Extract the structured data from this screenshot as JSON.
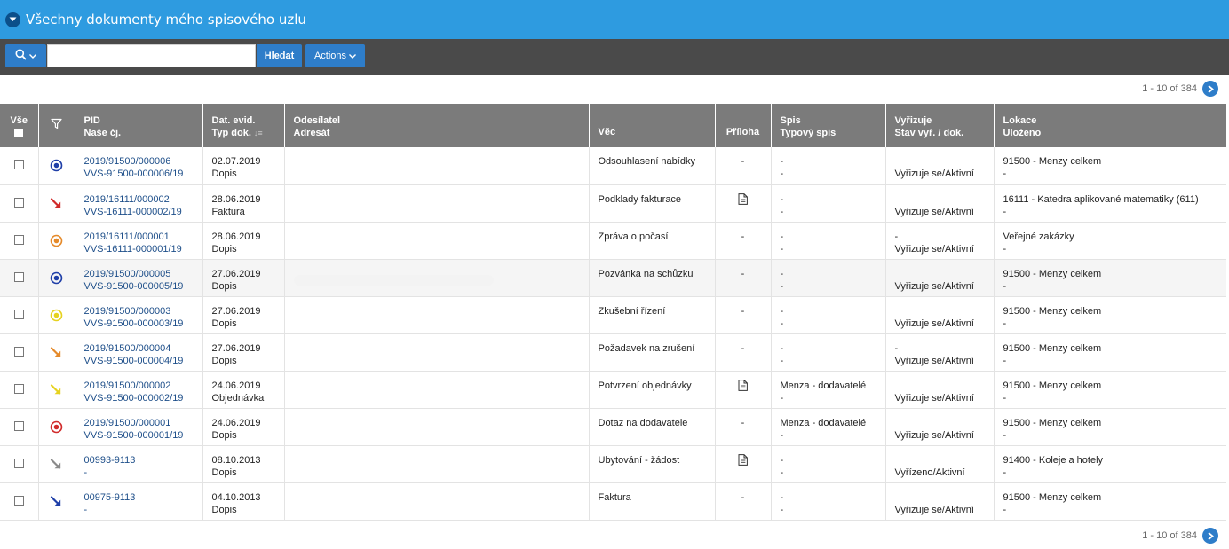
{
  "header": {
    "title": "Všechny dokumenty mého spisového uzlu",
    "colors": {
      "titlebar": "#2e9be0",
      "toolbar": "#4a4a4a",
      "button": "#2e7dc9",
      "table_header": "#7b7b7b"
    }
  },
  "toolbar": {
    "search_value": "",
    "search_button_label": "Hledat",
    "actions_label": "Actions",
    "search_icon": "search-icon"
  },
  "pagination": {
    "label": "1 - 10 of 384"
  },
  "columns": {
    "select_all": "Vše",
    "pid": "PID",
    "our_ref": "Naše čj.",
    "date": "Dat. evid.",
    "doc_type": "Typ dok.",
    "sender": "Odesílatel",
    "addressee": "Adresát",
    "subject": "Věc",
    "attachment": "Příloha",
    "file": "Spis",
    "file_type": "Typový spis",
    "handles": "Vyřizuje",
    "status": "Stav vyř. / dok.",
    "location": "Lokace",
    "stored": "Uloženo"
  },
  "rows": [
    {
      "icon": "target-circle-icon",
      "icon_color": "#1f3fa8",
      "pid": "2019/91500/000006",
      "ref": "VVS-91500-000006/19",
      "date": "02.07.2019",
      "type": "Dopis",
      "subject": "Odsouhlasení nabídky",
      "attachment": "-",
      "file1": "-",
      "file2": "-",
      "handler": "",
      "status": "Vyřizuje se/Aktivní",
      "loc1": "91500 - Menzy celkem",
      "loc2": "-"
    },
    {
      "icon": "arrow-down-right-icon",
      "icon_color": "#d12b2b",
      "pid": "2019/16111/000002",
      "ref": "VVS-16111-000002/19",
      "date": "28.06.2019",
      "type": "Faktura",
      "subject": "Podklady fakturace",
      "attachment": "document-icon",
      "file1": "-",
      "file2": "-",
      "handler": "",
      "status": "Vyřizuje se/Aktivní",
      "loc1": "16111 - Katedra aplikované matematiky (611)",
      "loc2": "-"
    },
    {
      "icon": "target-circle-icon",
      "icon_color": "#e58a2a",
      "pid": "2019/16111/000001",
      "ref": "VVS-16111-000001/19",
      "date": "28.06.2019",
      "type": "Dopis",
      "subject": "Zpráva o počasí",
      "attachment": "-",
      "file1": "-",
      "file2": "-",
      "handler": "-",
      "status": "Vyřizuje se/Aktivní",
      "loc1": "Veřejné zakázky",
      "loc2": "-"
    },
    {
      "icon": "target-circle-icon",
      "icon_color": "#1f3fa8",
      "pid": "2019/91500/000005",
      "ref": "VVS-91500-000005/19",
      "date": "27.06.2019",
      "type": "Dopis",
      "subject": "Pozvánka na schůzku",
      "attachment": "-",
      "file1": "-",
      "file2": "-",
      "handler": "",
      "status": "Vyřizuje se/Aktivní",
      "loc1": "91500 - Menzy celkem",
      "loc2": "-"
    },
    {
      "icon": "target-circle-icon",
      "icon_color": "#e6d21f",
      "pid": "2019/91500/000003",
      "ref": "VVS-91500-000003/19",
      "date": "27.06.2019",
      "type": "Dopis",
      "subject": "Zkušební řízení",
      "attachment": "-",
      "file1": "-",
      "file2": "-",
      "handler": "",
      "status": "Vyřizuje se/Aktivní",
      "loc1": "91500 - Menzy celkem",
      "loc2": "-"
    },
    {
      "icon": "arrow-down-right-icon",
      "icon_color": "#e58a2a",
      "pid": "2019/91500/000004",
      "ref": "VVS-91500-000004/19",
      "date": "27.06.2019",
      "type": "Dopis",
      "subject": "Požadavek na zrušení",
      "attachment": "-",
      "file1": "-",
      "file2": "-",
      "handler": "-",
      "status": "Vyřizuje se/Aktivní",
      "loc1": "91500 - Menzy celkem",
      "loc2": "-"
    },
    {
      "icon": "arrow-down-right-icon",
      "icon_color": "#e6d21f",
      "pid": "2019/91500/000002",
      "ref": "VVS-91500-000002/19",
      "date": "24.06.2019",
      "type": "Objednávka",
      "subject": "Potvrzení objednávky",
      "attachment": "document-icon",
      "file1": "Menza - dodavatelé",
      "file2": "-",
      "handler": "",
      "status": "Vyřizuje se/Aktivní",
      "loc1": "91500 - Menzy celkem",
      "loc2": "-"
    },
    {
      "icon": "target-circle-icon",
      "icon_color": "#d12b2b",
      "pid": "2019/91500/000001",
      "ref": "VVS-91500-000001/19",
      "date": "24.06.2019",
      "type": "Dopis",
      "subject": "Dotaz na dodavatele",
      "attachment": "-",
      "file1": "Menza - dodavatelé",
      "file2": "-",
      "handler": "",
      "status": "Vyřizuje se/Aktivní",
      "loc1": "91500 - Menzy celkem",
      "loc2": "-"
    },
    {
      "icon": "arrow-down-right-icon",
      "icon_color": "#8a8a8a",
      "pid": "00993-9113",
      "ref": "-",
      "date": "08.10.2013",
      "type": "Dopis",
      "subject": "Ubytování - žádost",
      "attachment": "document-icon",
      "file1": "-",
      "file2": "-",
      "handler": "",
      "status": "Vyřízeno/Aktivní",
      "loc1": "91400 - Koleje a hotely",
      "loc2": "-"
    },
    {
      "icon": "arrow-down-right-icon",
      "icon_color": "#1f3fa8",
      "pid": "00975-9113",
      "ref": "-",
      "date": "04.10.2013",
      "type": "Dopis",
      "subject": "Faktura",
      "attachment": "-",
      "file1": "-",
      "file2": "-",
      "handler": "",
      "status": "Vyřizuje se/Aktivní",
      "loc1": "91500 - Menzy celkem",
      "loc2": "-"
    }
  ]
}
